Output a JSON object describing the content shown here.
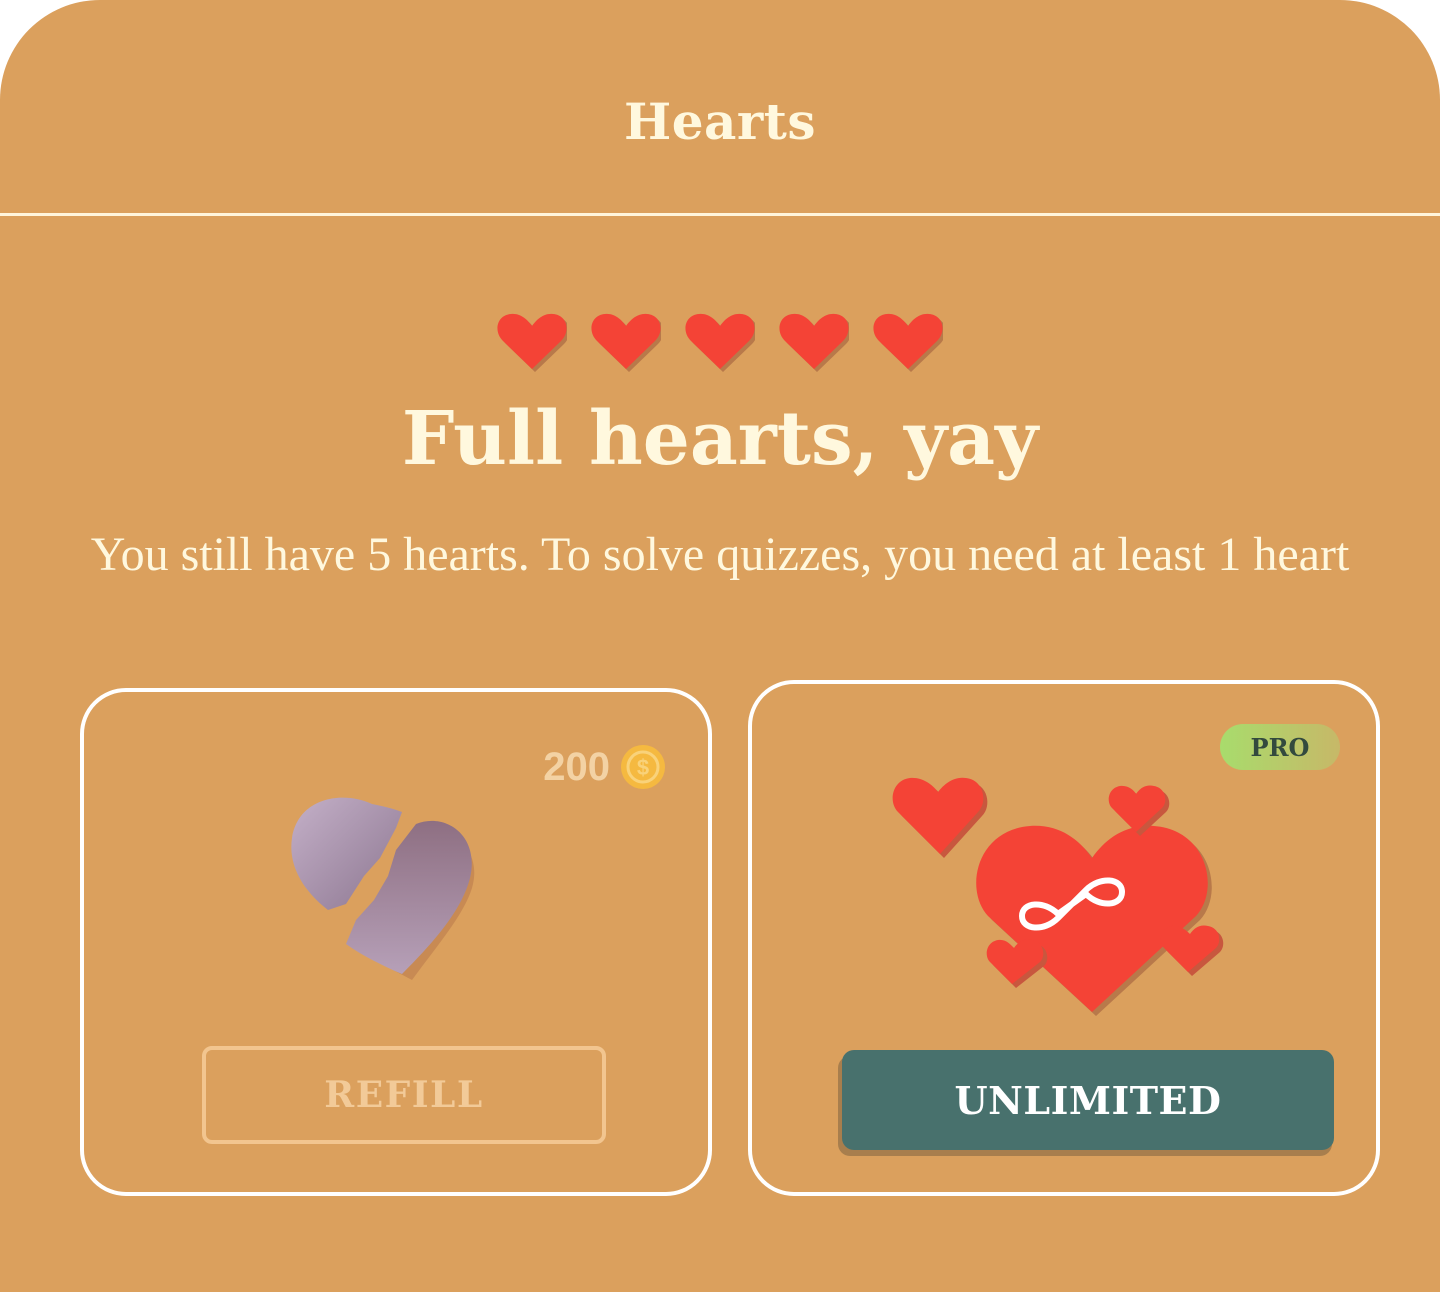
{
  "header": {
    "title": "Hearts"
  },
  "status": {
    "hearts_count": 5,
    "headline": "Full hearts, yay",
    "message": "You still have 5 hearts. To solve quizzes, you need at least 1 heart"
  },
  "refill_card": {
    "price": "200",
    "price_icon": "coin-icon",
    "image_icon": "broken-heart-icon",
    "button_label": "REFILL"
  },
  "unlimited_card": {
    "badge": "PRO",
    "image_icon": "infinite-hearts-icon",
    "button_label": "UNLIMITED"
  },
  "colors": {
    "background": "#DBA05D",
    "text": "#FFF8DE",
    "heart": "#F44336",
    "heart_shadow": "#B8794A",
    "unlimited_button": "#48716D",
    "pro_badge_start": "#A8DC6C",
    "pro_badge_end": "#C7B868",
    "coin": "#F5B940",
    "refill_border": "#F2C58F"
  }
}
